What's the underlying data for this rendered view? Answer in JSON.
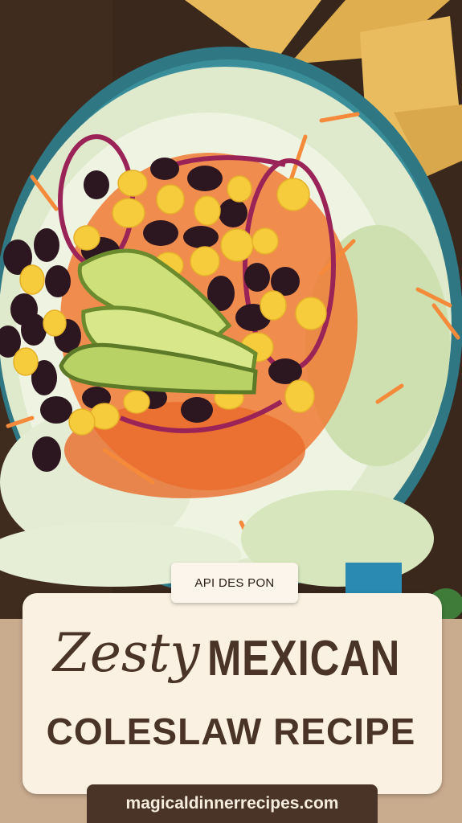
{
  "badge": {
    "label": "API DES PON"
  },
  "title": {
    "word1": "Zesty",
    "word2": "MEXICAN",
    "line2": "COLESLAW RECIPE"
  },
  "footer": {
    "url": "magicaldinnerrecipes.com"
  },
  "colors": {
    "card": "#fbf1e2",
    "title_text": "#4a3427",
    "url_bg": "#4a3427",
    "bowl": "#2f7f8c",
    "wood": "#3d2a1e"
  }
}
